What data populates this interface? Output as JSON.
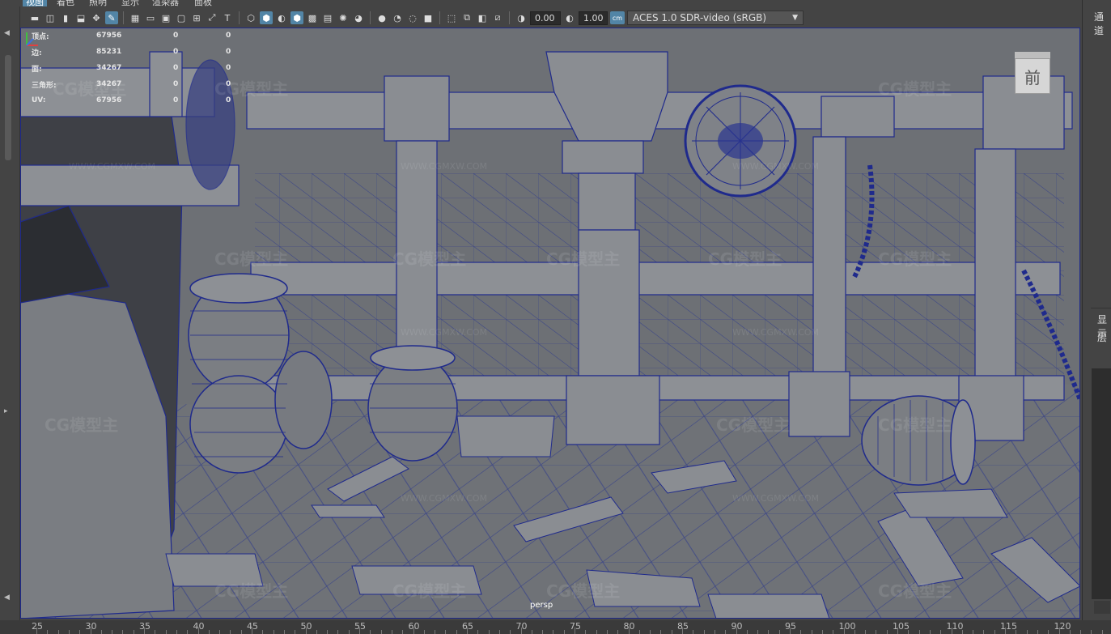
{
  "menubar": [
    "视图",
    "着色",
    "照明",
    "显示",
    "渲染器",
    "面板"
  ],
  "toolbar": {
    "exposure": "0.00",
    "gamma": "1.00",
    "colorspace": "ACES 1.0 SDR-video (sRGB)",
    "colorspace_icon": "cm"
  },
  "hud": {
    "rows": [
      {
        "label": "顶点:",
        "v1": "67956",
        "v2": "0",
        "v3": "0"
      },
      {
        "label": "边:",
        "v1": "85231",
        "v2": "0",
        "v3": "0"
      },
      {
        "label": "面:",
        "v1": "34267",
        "v2": "0",
        "v3": "0"
      },
      {
        "label": "三角形:",
        "v1": "34267",
        "v2": "0",
        "v3": "0"
      },
      {
        "label": "UV:",
        "v1": "67956",
        "v2": "0",
        "v3": "0"
      }
    ]
  },
  "viewport": {
    "camera": "persp",
    "viewcube": "前",
    "watermark": "CG模型主",
    "watermark_url": "WWW.CGMXW.COM"
  },
  "rightpanel": {
    "tab": "通道",
    "label1": "显示",
    "label2": "层"
  },
  "timeline": {
    "ticks": [
      "25",
      "30",
      "35",
      "40",
      "45",
      "50",
      "55",
      "60",
      "65",
      "70",
      "75",
      "80",
      "85",
      "90",
      "95",
      "100",
      "105",
      "110",
      "115",
      "120"
    ]
  },
  "colors": {
    "accent": "#5285a6",
    "wire": "#1f2a8c",
    "mesh": "#7a7d82"
  }
}
